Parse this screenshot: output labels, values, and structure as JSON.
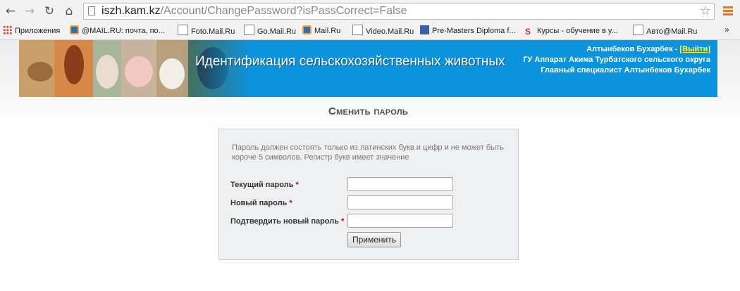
{
  "browser": {
    "url_host": "iszh.kam.kz",
    "url_path": "/Account/ChangePassword?isPassCorrect=False",
    "bookmarks": [
      {
        "label": "Приложения",
        "icon": "apps-icon"
      },
      {
        "label": "@MAIL.RU: почта, по...",
        "icon": "mail-ru-icon"
      },
      {
        "label": "Foto.Mail.Ru",
        "icon": "page-icon"
      },
      {
        "label": "Go.Mail.Ru",
        "icon": "page-icon"
      },
      {
        "label": "Mail.Ru",
        "icon": "mail-ru-icon"
      },
      {
        "label": "Video.Mail.Ru",
        "icon": "page-icon"
      },
      {
        "label": "Pre-Masters Diploma f...",
        "icon": "university-icon"
      },
      {
        "label": "Курсы - обучение в у...",
        "icon": "s-logo-icon"
      },
      {
        "label": "Авто@Mail.Ru",
        "icon": "page-icon"
      }
    ],
    "more": "»"
  },
  "header": {
    "site_title": "Идентификация сельскохозяйственных животных",
    "user_name": "Алтынбеков Бухарбек - ",
    "logout_label": "[Выйти]",
    "organization": "ГУ Аппарат Акима Турбатского сельского округа",
    "position": "Главный специалист Алтынбеков Бухарбек",
    "banner_color": "#0b93dd"
  },
  "form": {
    "heading": "Сменить пароль",
    "hint": "Пароль должен состоять только из латинских букв и цифр и не может быть короче 5 символов. Регистр букв имеет значение",
    "fields": [
      {
        "label": "Текущий пароль",
        "value": ""
      },
      {
        "label": "Новый пароль",
        "value": ""
      },
      {
        "label": "Подтвердить новый пароль",
        "value": ""
      }
    ],
    "required_mark": "*",
    "submit_label": "Применить"
  }
}
